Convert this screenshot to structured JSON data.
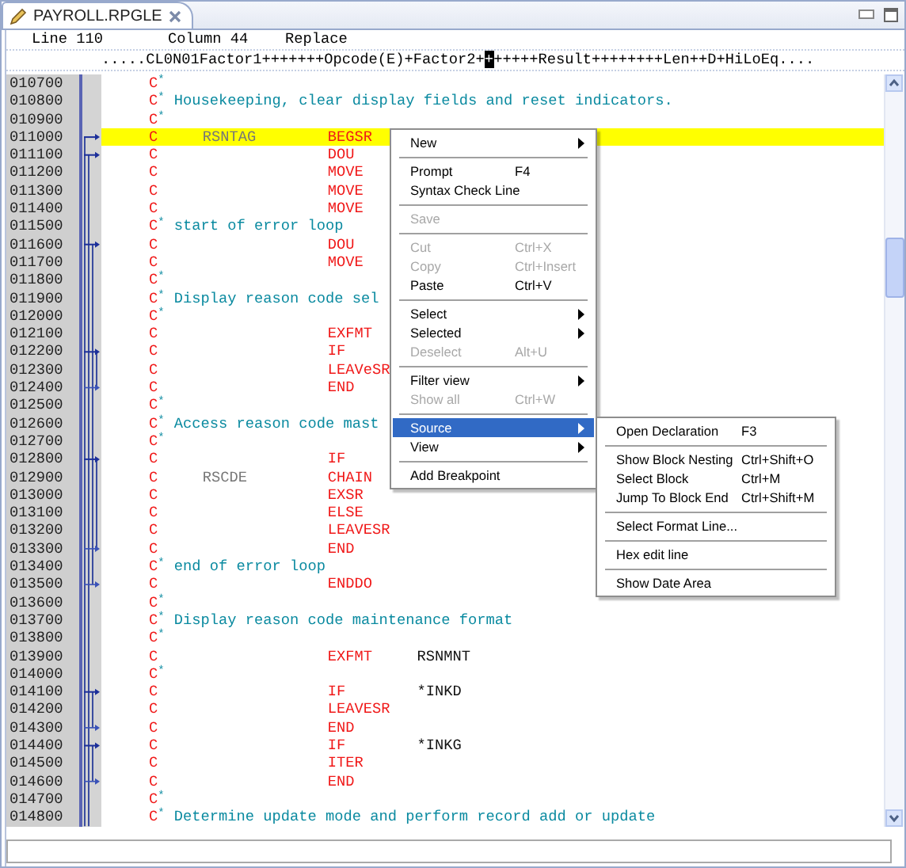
{
  "tab": {
    "title": "PAYROLL.RPGLE",
    "selected": true
  },
  "status": {
    "line": "Line 110",
    "column": "Column 44",
    "mode": "Replace"
  },
  "ruler": {
    "before": ".....CL0N01Factor1+++++++Opcode(E)+Factor2+",
    "cursor": "+",
    "after": "+++++Result++++++++Len++D+HiLoEq...."
  },
  "rows": [
    {
      "seq": "010700",
      "kind": "comment",
      "spec": "C",
      "mark": "*",
      "current": false,
      "block_start": false,
      "block_end": false
    },
    {
      "seq": "010800",
      "kind": "comment",
      "spec": "C",
      "mark": "*",
      "text": "Housekeeping, clear display fields and reset indicators.",
      "current": false,
      "block_start": false,
      "block_end": false
    },
    {
      "seq": "010900",
      "kind": "comment",
      "spec": "C",
      "mark": "*",
      "current": false,
      "block_start": false,
      "block_end": false
    },
    {
      "seq": "011000",
      "kind": "calc",
      "spec": "C",
      "factor1": "RSNTAG",
      "opcode": "BEGSR",
      "current": true,
      "block_start": true,
      "block_end": false
    },
    {
      "seq": "011100",
      "kind": "calc",
      "spec": "C",
      "opcode": "DOU",
      "current": false,
      "block_start": true,
      "block_end": false
    },
    {
      "seq": "011200",
      "kind": "calc",
      "spec": "C",
      "opcode": "MOVE",
      "current": false,
      "block_start": false,
      "block_end": false
    },
    {
      "seq": "011300",
      "kind": "calc",
      "spec": "C",
      "opcode": "MOVE",
      "current": false,
      "block_start": false,
      "block_end": false
    },
    {
      "seq": "011400",
      "kind": "calc",
      "spec": "C",
      "opcode": "MOVE",
      "current": false,
      "block_start": false,
      "block_end": false
    },
    {
      "seq": "011500",
      "kind": "comment",
      "spec": "C",
      "mark": "*",
      "text": "start of error loop",
      "current": false,
      "block_start": false,
      "block_end": false
    },
    {
      "seq": "011600",
      "kind": "calc",
      "spec": "C",
      "opcode": "DOU",
      "current": false,
      "block_start": true,
      "block_end": false
    },
    {
      "seq": "011700",
      "kind": "calc",
      "spec": "C",
      "opcode": "MOVE",
      "current": false,
      "block_start": false,
      "block_end": false
    },
    {
      "seq": "011800",
      "kind": "comment",
      "spec": "C",
      "mark": "*",
      "current": false,
      "block_start": false,
      "block_end": false
    },
    {
      "seq": "011900",
      "kind": "comment",
      "spec": "C",
      "mark": "*",
      "text": "Display reason code sel",
      "current": false,
      "block_start": false,
      "block_end": false
    },
    {
      "seq": "012000",
      "kind": "comment",
      "spec": "C",
      "mark": "*",
      "current": false,
      "block_start": false,
      "block_end": false
    },
    {
      "seq": "012100",
      "kind": "calc",
      "spec": "C",
      "opcode": "EXFMT",
      "current": false,
      "block_start": false,
      "block_end": false
    },
    {
      "seq": "012200",
      "kind": "calc",
      "spec": "C",
      "opcode": "IF",
      "current": false,
      "block_start": true,
      "block_end": false
    },
    {
      "seq": "012300",
      "kind": "calc",
      "spec": "C",
      "opcode": "LEAVeSR",
      "current": false,
      "block_start": false,
      "block_end": false
    },
    {
      "seq": "012400",
      "kind": "calc",
      "spec": "C",
      "opcode": "END",
      "current": false,
      "block_start": false,
      "block_end": true
    },
    {
      "seq": "012500",
      "kind": "comment",
      "spec": "C",
      "mark": "*",
      "current": false,
      "block_start": false,
      "block_end": false
    },
    {
      "seq": "012600",
      "kind": "comment",
      "spec": "C",
      "mark": "*",
      "text": "Access reason code mast",
      "current": false,
      "block_start": false,
      "block_end": false
    },
    {
      "seq": "012700",
      "kind": "comment",
      "spec": "C",
      "mark": "*",
      "current": false,
      "block_start": false,
      "block_end": false
    },
    {
      "seq": "012800",
      "kind": "calc",
      "spec": "C",
      "opcode": "IF",
      "current": false,
      "block_start": true,
      "block_end": false
    },
    {
      "seq": "012900",
      "kind": "calc",
      "spec": "C",
      "factor1": "RSCDE",
      "opcode": "CHAIN",
      "current": false,
      "block_start": false,
      "block_end": false
    },
    {
      "seq": "013000",
      "kind": "calc",
      "spec": "C",
      "opcode": "EXSR",
      "current": false,
      "block_start": false,
      "block_end": false
    },
    {
      "seq": "013100",
      "kind": "calc",
      "spec": "C",
      "opcode": "ELSE",
      "current": false,
      "block_start": false,
      "block_end": false
    },
    {
      "seq": "013200",
      "kind": "calc",
      "spec": "C",
      "opcode": "LEAVESR",
      "current": false,
      "block_start": false,
      "block_end": false
    },
    {
      "seq": "013300",
      "kind": "calc",
      "spec": "C",
      "opcode": "END",
      "current": false,
      "block_start": false,
      "block_end": true
    },
    {
      "seq": "013400",
      "kind": "comment",
      "spec": "C",
      "mark": "*",
      "text": "end of error loop",
      "current": false,
      "block_start": false,
      "block_end": false
    },
    {
      "seq": "013500",
      "kind": "calc",
      "spec": "C",
      "opcode": "ENDDO",
      "current": false,
      "block_start": false,
      "block_end": true
    },
    {
      "seq": "013600",
      "kind": "comment",
      "spec": "C",
      "mark": "*",
      "current": false,
      "block_start": false,
      "block_end": false
    },
    {
      "seq": "013700",
      "kind": "comment",
      "spec": "C",
      "mark": "*",
      "text": "Display reason code maintenance format",
      "current": false,
      "block_start": false,
      "block_end": false
    },
    {
      "seq": "013800",
      "kind": "comment",
      "spec": "C",
      "mark": "*",
      "current": false,
      "block_start": false,
      "block_end": false
    },
    {
      "seq": "013900",
      "kind": "calc",
      "spec": "C",
      "opcode": "EXFMT",
      "factor2": "RSNMNT",
      "current": false,
      "block_start": false,
      "block_end": false
    },
    {
      "seq": "014000",
      "kind": "comment",
      "spec": "C",
      "mark": "*",
      "current": false,
      "block_start": false,
      "block_end": false
    },
    {
      "seq": "014100",
      "kind": "calc",
      "spec": "C",
      "opcode": "IF",
      "factor2": "*INKD",
      "current": false,
      "block_start": true,
      "block_end": false
    },
    {
      "seq": "014200",
      "kind": "calc",
      "spec": "C",
      "opcode": "LEAVESR",
      "current": false,
      "block_start": false,
      "block_end": false
    },
    {
      "seq": "014300",
      "kind": "calc",
      "spec": "C",
      "opcode": "END",
      "current": false,
      "block_start": false,
      "block_end": true
    },
    {
      "seq": "014400",
      "kind": "calc",
      "spec": "C",
      "opcode": "IF",
      "factor2": "*INKG",
      "current": false,
      "block_start": true,
      "block_end": false
    },
    {
      "seq": "014500",
      "kind": "calc",
      "spec": "C",
      "opcode": "ITER",
      "current": false,
      "block_start": false,
      "block_end": false
    },
    {
      "seq": "014600",
      "kind": "calc",
      "spec": "C",
      "opcode": "END",
      "current": false,
      "block_start": false,
      "block_end": true
    },
    {
      "seq": "014700",
      "kind": "comment",
      "spec": "C",
      "mark": "*",
      "current": false,
      "block_start": false,
      "block_end": false
    },
    {
      "seq": "014800",
      "kind": "comment",
      "spec": "C",
      "mark": "*",
      "text": "Determine update mode and perform record add or update",
      "current": false,
      "block_start": false,
      "block_end": false
    }
  ],
  "context_menu": [
    {
      "kind": "item",
      "label": "New",
      "submenu": true,
      "disabled": false,
      "selected": false
    },
    {
      "kind": "separator"
    },
    {
      "kind": "item",
      "label": "Prompt",
      "shortcut": "F4",
      "submenu": false,
      "disabled": false,
      "selected": false
    },
    {
      "kind": "item",
      "label": "Syntax Check Line",
      "submenu": false,
      "disabled": false,
      "selected": false
    },
    {
      "kind": "separator"
    },
    {
      "kind": "item",
      "label": "Save",
      "submenu": false,
      "disabled": true,
      "selected": false
    },
    {
      "kind": "separator"
    },
    {
      "kind": "item",
      "label": "Cut",
      "shortcut": "Ctrl+X",
      "submenu": false,
      "disabled": true,
      "selected": false
    },
    {
      "kind": "item",
      "label": "Copy",
      "shortcut": "Ctrl+Insert",
      "submenu": false,
      "disabled": true,
      "selected": false
    },
    {
      "kind": "item",
      "label": "Paste",
      "shortcut": "Ctrl+V",
      "submenu": false,
      "disabled": false,
      "selected": false
    },
    {
      "kind": "separator"
    },
    {
      "kind": "item",
      "label": "Select",
      "submenu": true,
      "disabled": false,
      "selected": false
    },
    {
      "kind": "item",
      "label": "Selected",
      "submenu": true,
      "disabled": false,
      "selected": false
    },
    {
      "kind": "item",
      "label": "Deselect",
      "shortcut": "Alt+U",
      "submenu": false,
      "disabled": true,
      "selected": false
    },
    {
      "kind": "separator"
    },
    {
      "kind": "item",
      "label": "Filter view",
      "submenu": true,
      "disabled": false,
      "selected": false
    },
    {
      "kind": "item",
      "label": "Show all",
      "shortcut": "Ctrl+W",
      "submenu": false,
      "disabled": true,
      "selected": false
    },
    {
      "kind": "separator"
    },
    {
      "kind": "item",
      "label": "Source",
      "submenu": true,
      "disabled": false,
      "selected": true
    },
    {
      "kind": "item",
      "label": "View",
      "submenu": true,
      "disabled": false,
      "selected": false
    },
    {
      "kind": "separator"
    },
    {
      "kind": "item",
      "label": "Add Breakpoint",
      "submenu": false,
      "disabled": false,
      "selected": false
    }
  ],
  "source_submenu": [
    {
      "kind": "item",
      "label": "Open Declaration",
      "shortcut": "F3",
      "submenu": false,
      "disabled": false,
      "selected": false
    },
    {
      "kind": "separator"
    },
    {
      "kind": "item",
      "label": "Show Block Nesting",
      "shortcut": "Ctrl+Shift+O",
      "submenu": false,
      "disabled": false,
      "selected": false
    },
    {
      "kind": "item",
      "label": "Select Block",
      "shortcut": "Ctrl+M",
      "submenu": false,
      "disabled": false,
      "selected": false
    },
    {
      "kind": "item",
      "label": "Jump To Block End",
      "shortcut": "Ctrl+Shift+M",
      "submenu": false,
      "disabled": false,
      "selected": false
    },
    {
      "kind": "separator"
    },
    {
      "kind": "item",
      "label": "Select Format Line...",
      "submenu": false,
      "disabled": false,
      "selected": false
    },
    {
      "kind": "separator"
    },
    {
      "kind": "item",
      "label": "Hex edit line",
      "submenu": false,
      "disabled": false,
      "selected": false
    },
    {
      "kind": "separator"
    },
    {
      "kind": "item",
      "label": "Show Date Area",
      "submenu": false,
      "disabled": false,
      "selected": false
    }
  ]
}
